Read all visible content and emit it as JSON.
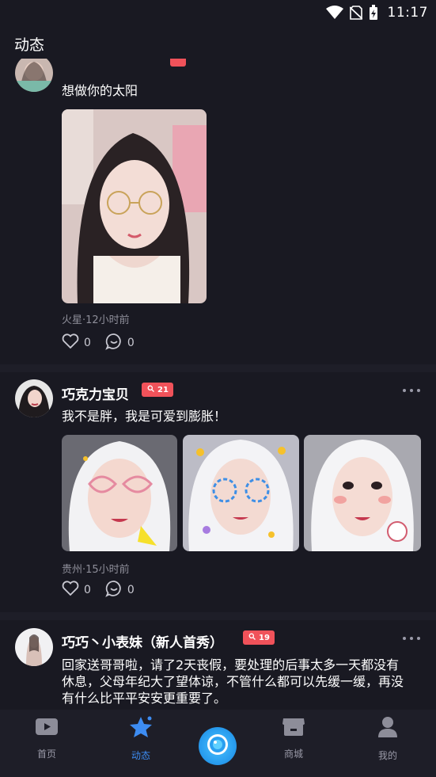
{
  "status_bar": {
    "time": "11:17"
  },
  "header": {
    "title": "动态"
  },
  "posts": [
    {
      "username": "",
      "text": "想做你的太阳",
      "meta": "火星·12小时前",
      "likes": "0",
      "comments": "0"
    },
    {
      "username": "巧克力宝贝",
      "badge": "21",
      "text": "我不是胖，我是可爱到膨胀！",
      "meta": "贵州·15小时前",
      "likes": "0",
      "comments": "0"
    },
    {
      "username": "巧巧丶小表妹（新人首秀）",
      "badge": "19",
      "text": "回家送哥哥啦，请了2天丧假，要处理的后事太多一天都没有休息，父母年纪大了望体谅，不管什么都可以先缓一缓，再没有什么比平平安安更重要了。"
    }
  ],
  "nav": {
    "home": "首页",
    "feed": "动态",
    "shop": "商城",
    "mine": "我的"
  },
  "colors": {
    "background": "#191922",
    "accent": "#3d8cf2",
    "badge": "#f0525a",
    "meta_text": "#8e8e99"
  },
  "icons": [
    "wifi-icon",
    "no-sim-icon",
    "battery-charging-icon",
    "heart-icon",
    "comment-icon",
    "more-icon",
    "tv-icon",
    "star-icon",
    "live-camera-icon",
    "shop-icon",
    "user-icon"
  ]
}
